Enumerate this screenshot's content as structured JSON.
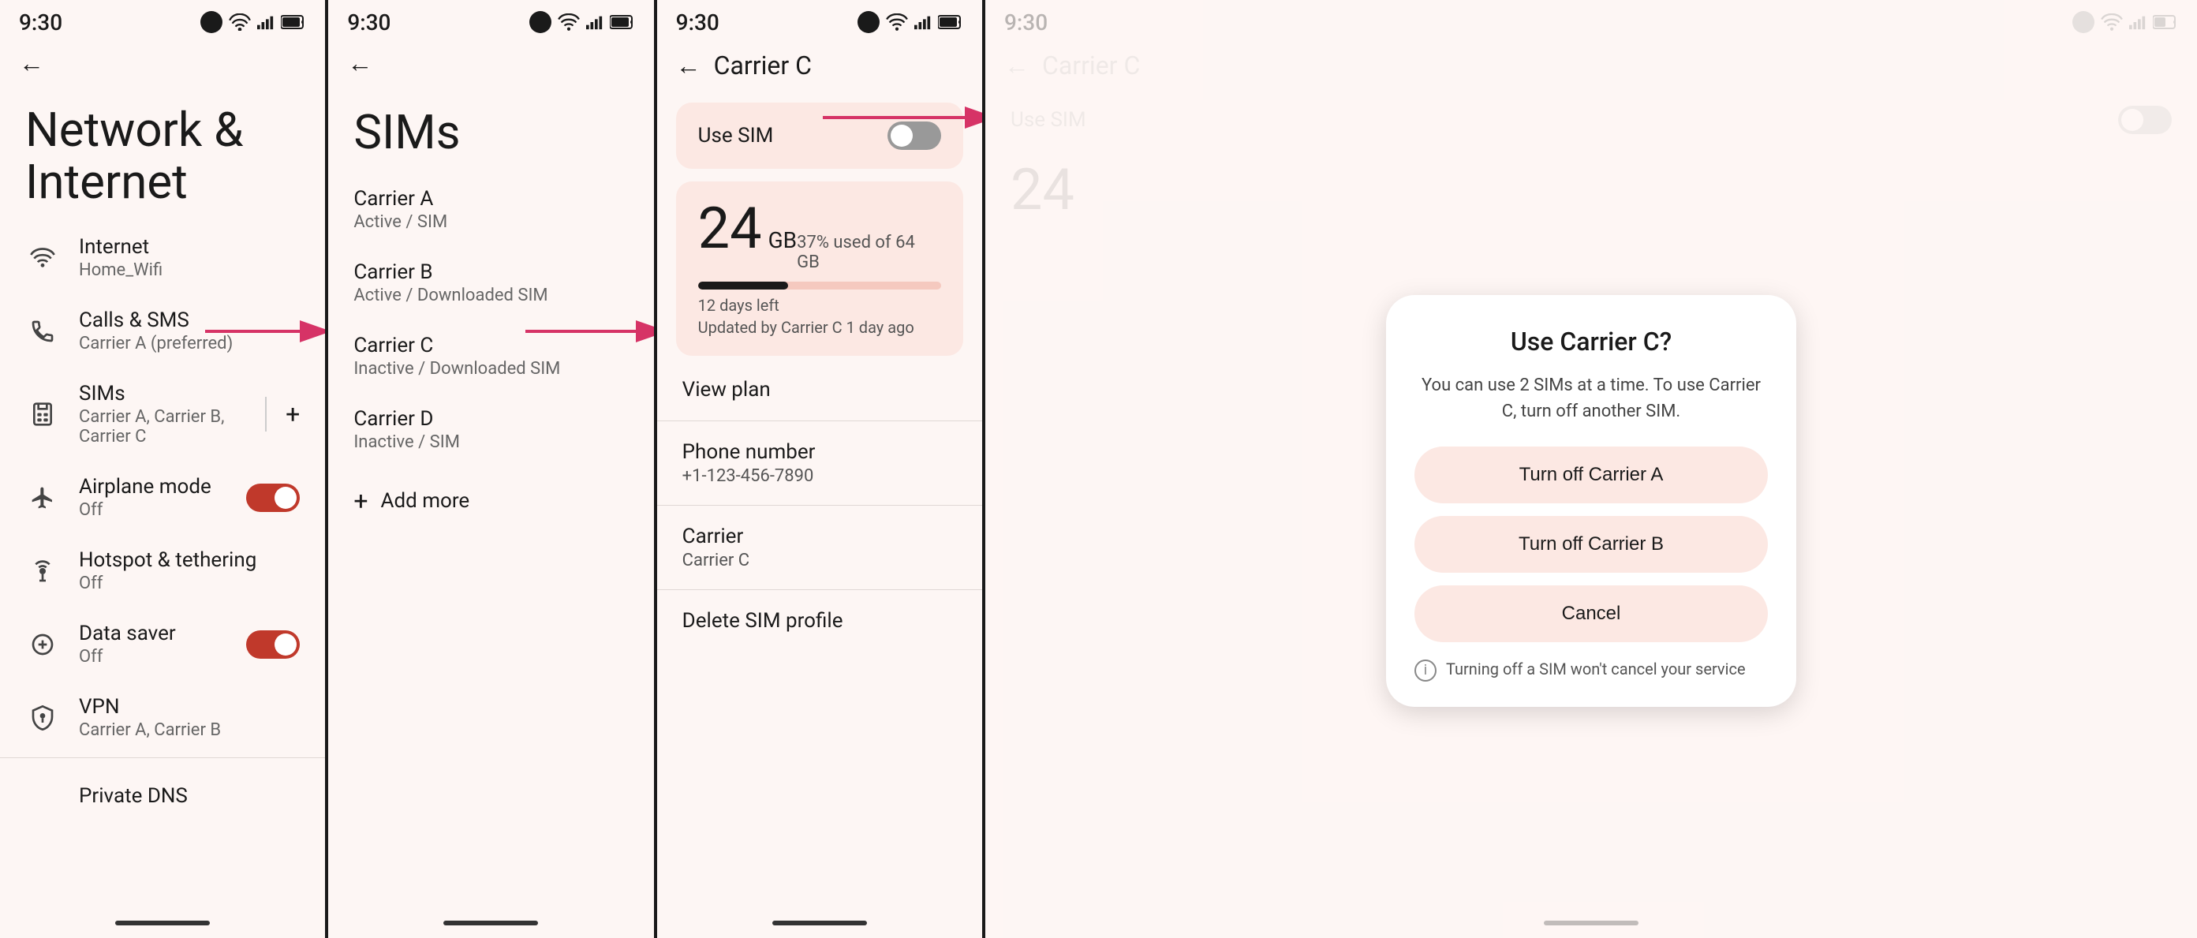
{
  "screen1": {
    "time": "9:30",
    "title": "Network & Internet",
    "menu_items": [
      {
        "id": "internet",
        "icon": "wifi",
        "title": "Internet",
        "subtitle": "Home_Wifi"
      },
      {
        "id": "calls_sms",
        "icon": "phone",
        "title": "Calls & SMS",
        "subtitle": "Carrier A (preferred)"
      },
      {
        "id": "sims",
        "icon": "sim",
        "title": "SIMs",
        "subtitle": "Carrier A, Carrier B, Carrier C",
        "has_add": true
      },
      {
        "id": "airplane",
        "icon": "airplane",
        "title": "Airplane mode",
        "subtitle": "Off",
        "toggle": true,
        "toggle_state": "on"
      },
      {
        "id": "hotspot",
        "icon": "hotspot",
        "title": "Hotspot & tethering",
        "subtitle": "Off"
      },
      {
        "id": "data_saver",
        "icon": "data_saver",
        "title": "Data saver",
        "subtitle": "Off",
        "toggle": true,
        "toggle_state": "on"
      },
      {
        "id": "vpn",
        "icon": "vpn",
        "title": "VPN",
        "subtitle": "Carrier A, Carrier B"
      }
    ],
    "private_dns": "Private DNS"
  },
  "screen2": {
    "time": "9:30",
    "title": "SIMs",
    "back_label": "←",
    "carriers": [
      {
        "name": "Carrier A",
        "status": "Active / SIM"
      },
      {
        "name": "Carrier B",
        "status": "Active / Downloaded SIM"
      },
      {
        "name": "Carrier C",
        "status": "Inactive / Downloaded SIM"
      },
      {
        "name": "Carrier D",
        "status": "Inactive / SIM"
      }
    ],
    "add_more": "Add more"
  },
  "screen3": {
    "time": "9:30",
    "title": "Carrier C",
    "back_label": "←",
    "use_sim_label": "Use SIM",
    "use_sim_state": "off",
    "data": {
      "amount": "24",
      "unit": "GB",
      "percent": "37% used of 64 GB",
      "days_left": "12 days left",
      "updated": "Updated by Carrier C 1 day ago",
      "progress_pct": 37
    },
    "details": [
      {
        "title": "View plan",
        "value": ""
      },
      {
        "title": "Phone number",
        "value": "+1-123-456-7890"
      },
      {
        "title": "Carrier",
        "value": "Carrier C"
      },
      {
        "title": "Delete SIM profile",
        "value": ""
      }
    ]
  },
  "screen4": {
    "time": "9:30",
    "title": "Carrier C",
    "back_label": "←",
    "use_sim_label": "Use SIM",
    "data_number": "24",
    "dialog": {
      "title": "Use Carrier C?",
      "subtitle": "You can use 2 SIMs at a time. To use Carrier C, turn off another SIM.",
      "buttons": [
        {
          "label": "Turn off Carrier A",
          "id": "turn-off-a"
        },
        {
          "label": "Turn off Carrier B",
          "id": "turn-off-b"
        },
        {
          "label": "Cancel",
          "id": "cancel"
        }
      ],
      "footer": "Turning off a SIM won't cancel your service"
    }
  },
  "colors": {
    "accent": "#c0392b",
    "bg": "#fdf6f4",
    "card_bg": "#fce8e3",
    "toggle_on": "#c0392b",
    "toggle_off": "#aaa",
    "text_primary": "#1a1a1a",
    "text_secondary": "#666"
  }
}
